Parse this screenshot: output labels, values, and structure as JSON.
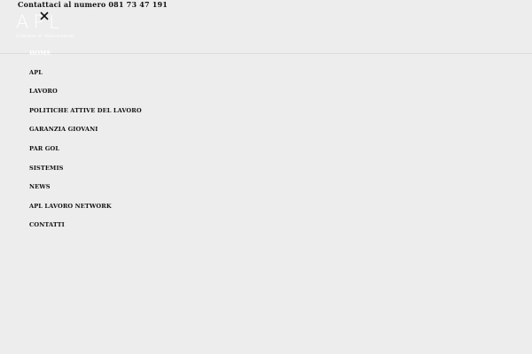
{
  "header": {
    "contact_text": "Contattaci al numero 081 73 47 191",
    "logo_text": "APL",
    "logo_subtitle": "Comune di Manocalzati"
  },
  "menu": {
    "items": [
      {
        "label": "HOME"
      },
      {
        "label": "APL"
      },
      {
        "label": "LAVORO"
      },
      {
        "label": "POLITICHE ATTIVE DEL LAVORO"
      },
      {
        "label": "GARANZIA GIOVANI"
      },
      {
        "label": "PAR GOL"
      },
      {
        "label": "SISTEMIS"
      },
      {
        "label": "NEWS"
      },
      {
        "label": "APL LAVORO NETWORK"
      },
      {
        "label": "CONTATTI"
      }
    ],
    "active_index": 0
  },
  "icons": {
    "close": "close-icon"
  },
  "colors": {
    "background": "#ededed",
    "text": "#111111",
    "active_item": "#ffffff",
    "logo": "#ffffff"
  }
}
